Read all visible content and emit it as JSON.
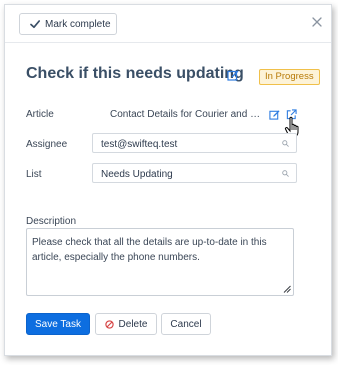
{
  "header": {
    "mark_complete_label": "Mark complete"
  },
  "task": {
    "title": "Check if this needs updating",
    "status_badge": "In Progress",
    "status_color": "#f0c04a"
  },
  "fields": {
    "article_label": "Article",
    "article_value": "Contact Details for Courier and Deli...",
    "assignee_label": "Assignee",
    "assignee_value": "test@swifteq.test",
    "list_label": "List",
    "list_value": "Needs Updating",
    "description_label": "Description",
    "description_value": "Please check that all the details are up-to-date in this article, especially the phone numbers."
  },
  "footer": {
    "save_label": "Save Task",
    "delete_label": "Delete",
    "cancel_label": "Cancel"
  },
  "colors": {
    "accent": "#0d6ee0",
    "title": "#3a4f66",
    "delete_icon": "#d64545"
  },
  "icons": [
    "check-icon",
    "close-icon",
    "edit-icon",
    "external-link-icon",
    "search-icon",
    "resize-grip-icon",
    "prohibited-icon",
    "hand-cursor-icon"
  ]
}
